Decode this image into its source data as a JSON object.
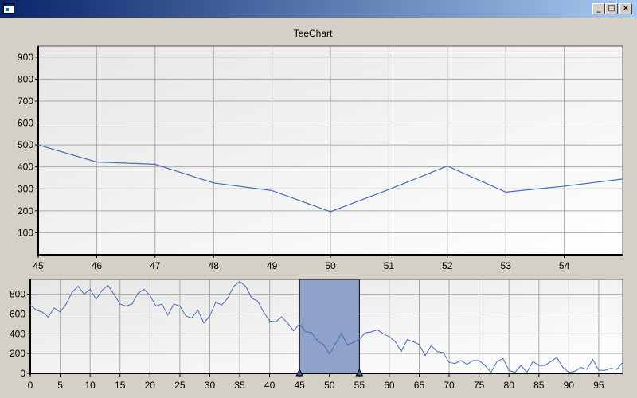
{
  "window": {
    "title": "",
    "icon": "app-window-icon",
    "controls": {
      "minimize": "_",
      "maximize": "□",
      "close": "×"
    }
  },
  "colors": {
    "title_text": "#0000ff",
    "series_line": "#4a6cb3",
    "zoom_fill": "#8fa2c9",
    "grid": "#a9a9a9"
  },
  "chart_data": [
    {
      "type": "line",
      "title": "TeeChart",
      "xlim": [
        45,
        55
      ],
      "ylim": [
        0,
        950
      ],
      "x_ticks": [
        45,
        46,
        47,
        48,
        49,
        50,
        51,
        52,
        53,
        54
      ],
      "y_ticks": [
        100,
        200,
        300,
        400,
        500,
        600,
        700,
        800,
        900
      ],
      "x": [
        45,
        46,
        47,
        48,
        49,
        50,
        51,
        52,
        53,
        54,
        55
      ],
      "y": [
        500,
        422,
        412,
        327,
        292,
        196,
        297,
        404,
        285,
        312,
        345
      ]
    },
    {
      "type": "line",
      "xlim": [
        0,
        99
      ],
      "ylim": [
        0,
        950
      ],
      "x_ticks": [
        0,
        5,
        10,
        15,
        20,
        25,
        30,
        35,
        40,
        45,
        50,
        55,
        60,
        65,
        70,
        75,
        80,
        85,
        90,
        95
      ],
      "y_ticks": [
        0,
        200,
        400,
        600,
        800
      ],
      "selection": {
        "from": 45,
        "to": 55
      },
      "y": [
        690,
        640,
        620,
        570,
        660,
        620,
        700,
        820,
        880,
        800,
        850,
        750,
        840,
        890,
        800,
        700,
        680,
        700,
        810,
        850,
        790,
        680,
        700,
        590,
        700,
        680,
        580,
        560,
        640,
        510,
        580,
        720,
        690,
        760,
        880,
        930,
        880,
        760,
        730,
        620,
        530,
        520,
        570,
        510,
        430,
        500,
        422,
        412,
        327,
        292,
        196,
        297,
        404,
        285,
        312,
        345,
        410,
        420,
        440,
        400,
        370,
        320,
        220,
        340,
        320,
        290,
        180,
        280,
        220,
        210,
        110,
        100,
        130,
        90,
        130,
        130,
        80,
        10,
        120,
        150,
        30,
        10,
        80,
        10,
        120,
        80,
        80,
        120,
        160,
        60,
        10,
        20,
        60,
        40,
        140,
        30,
        30,
        50,
        40,
        110
      ]
    }
  ]
}
